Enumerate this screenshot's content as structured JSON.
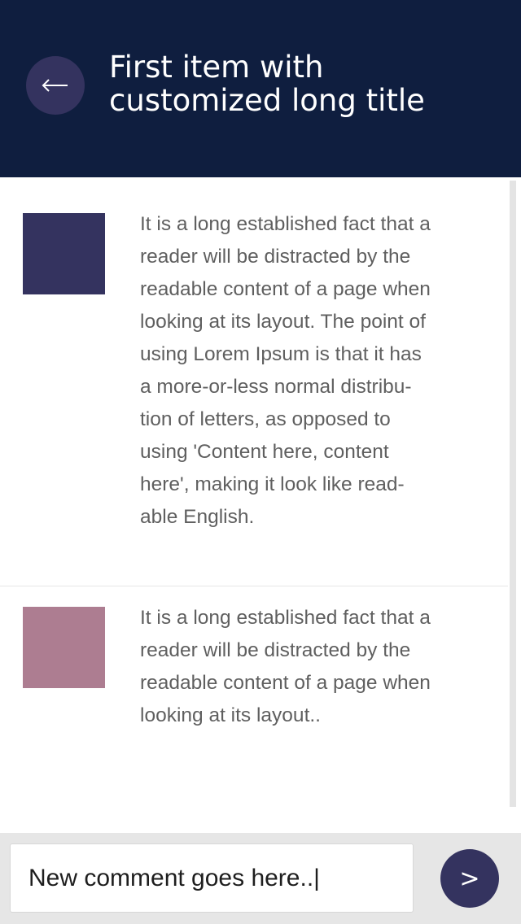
{
  "header": {
    "title_line1": "First item with",
    "title_line2": "customized long title",
    "back_icon": "arrow-left-icon",
    "background": "#0f1e3f",
    "button_color": "#34335f"
  },
  "items": [
    {
      "thumb_color": "#34335f",
      "lines": [
        "It is a long established fact that a",
        "reader will be distracted by the",
        "readable content of a page when",
        "looking at its layout. The point of",
        "using Lorem Ipsum is that it has",
        "a more-or-less normal distribu-",
        "tion of letters, as opposed to",
        "using 'Content here, content",
        "here', making it look like read-",
        "able English."
      ]
    },
    {
      "thumb_color": "#ad7d91",
      "lines": [
        "It is a long established fact that a",
        "reader will be distracted by the",
        "readable content of a page when",
        "looking at its layout.."
      ]
    }
  ],
  "footer": {
    "input_placeholder": "New comment goes here..|",
    "send_label": ">"
  }
}
